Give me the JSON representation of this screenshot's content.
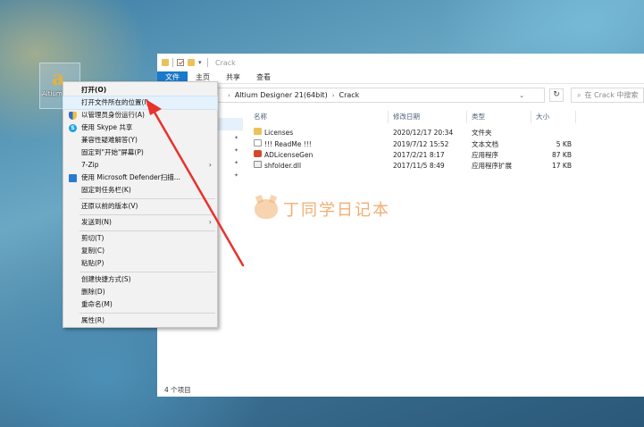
{
  "desktop_icon": {
    "label": "Altium Designer"
  },
  "window": {
    "title": "Crack",
    "ribbon_tabs": [
      "文件",
      "主页",
      "共享",
      "查看"
    ],
    "breadcrumb": [
      "Altium Designer 21(64bit)",
      "Crack"
    ],
    "search_placeholder": "在 Crack 中搜索",
    "columns": [
      "名称",
      "修改日期",
      "类型",
      "大小"
    ],
    "files": [
      {
        "name": "Licenses",
        "date": "2020/12/17 20:34",
        "type": "文件夹",
        "size": "",
        "icon": "folder-icon"
      },
      {
        "name": "!!! ReadMe !!!",
        "date": "2019/7/12 15:52",
        "type": "文本文档",
        "size": "5 KB",
        "icon": "text-file-icon"
      },
      {
        "name": "ADLicenseGen",
        "date": "2017/2/21 8:17",
        "type": "应用程序",
        "size": "87 KB",
        "icon": "exe-icon"
      },
      {
        "name": "shfolder.dll",
        "date": "2017/11/5 8:49",
        "type": "应用程序扩展",
        "size": "17 KB",
        "icon": "dll-icon"
      }
    ],
    "status": "4 个项目"
  },
  "watermark": "丁同学日记本",
  "context_menu": {
    "items": [
      "打开(O)",
      "打开文件所在的位置(I)",
      "以管理员身份运行(A)",
      "使用 Skype 共享",
      "兼容性疑难解答(Y)",
      "固定到\"开始\"屏幕(P)",
      "7-Zip",
      "使用 Microsoft Defender扫描...",
      "固定到任务栏(K)",
      "还原以前的版本(V)",
      "发送到(N)",
      "剪切(T)",
      "复制(C)",
      "粘贴(P)",
      "创建快捷方式(S)",
      "删除(D)",
      "重命名(M)",
      "属性(R)"
    ]
  },
  "colors": {
    "accent": "#1979ca",
    "annotation_arrow": "#e8322c",
    "menu_highlight": "#e5f1fb"
  }
}
